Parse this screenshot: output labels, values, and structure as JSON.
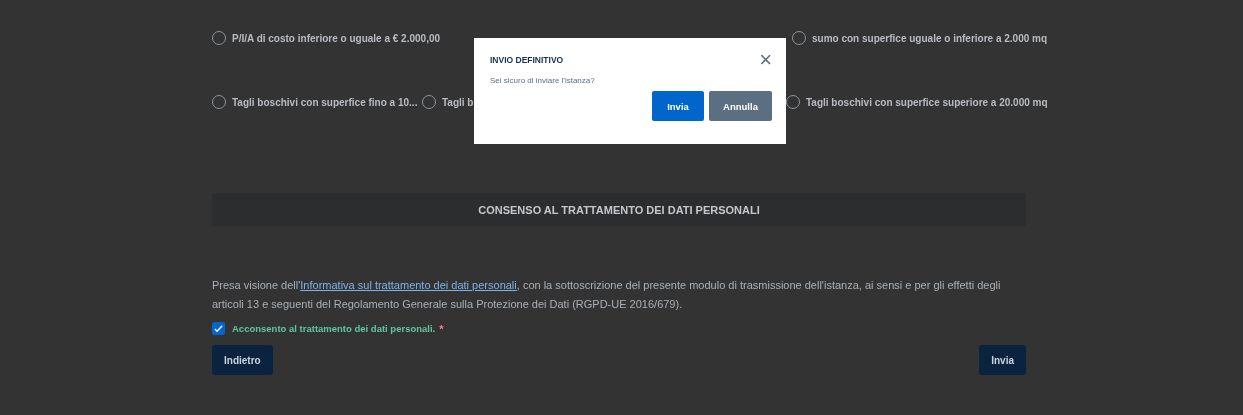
{
  "options_row_1": [
    {
      "label": "P/I/A di costo inferiore o uguale a € 2.000,00",
      "selected": false
    },
    {
      "label": "sumo con superfice uguale o inferiore a 2.000 mq",
      "selected": false
    }
  ],
  "options_row_2": [
    {
      "label": "Tagli boschivi con superfice fino a 10...",
      "selected": false
    },
    {
      "label": "Tagli b",
      "selected": false
    },
    {
      "label": "Tagli boschivi con superfice superiore a 20.000 mq",
      "selected": false
    }
  ],
  "section_title": "CONSENSO AL TRATTAMENTO DEI DATI PERSONALI",
  "consent_text": {
    "before": "Presa visione dell'",
    "link": "Informativa sul trattamento dei dati personali",
    "after": ", con la sottoscrizione del presente modulo di trasmissione dell'istanza, ai sensi e per gli effetti degli articoli 13 e seguenti del Regolamento Generale sulla Protezione dei Dati (RGPD-UE 2016/679)."
  },
  "consent_checkbox": {
    "label": "Acconsento al trattamento dei dati personali.",
    "required_mark": "*",
    "checked": true
  },
  "back_button": "Indietro",
  "submit_button": "Invia",
  "modal": {
    "title": "INVIO DEFINITIVO",
    "close": "×",
    "message": "Sei sicuro di inviare l'istanza?",
    "confirm": "Invia",
    "cancel": "Annulla"
  }
}
